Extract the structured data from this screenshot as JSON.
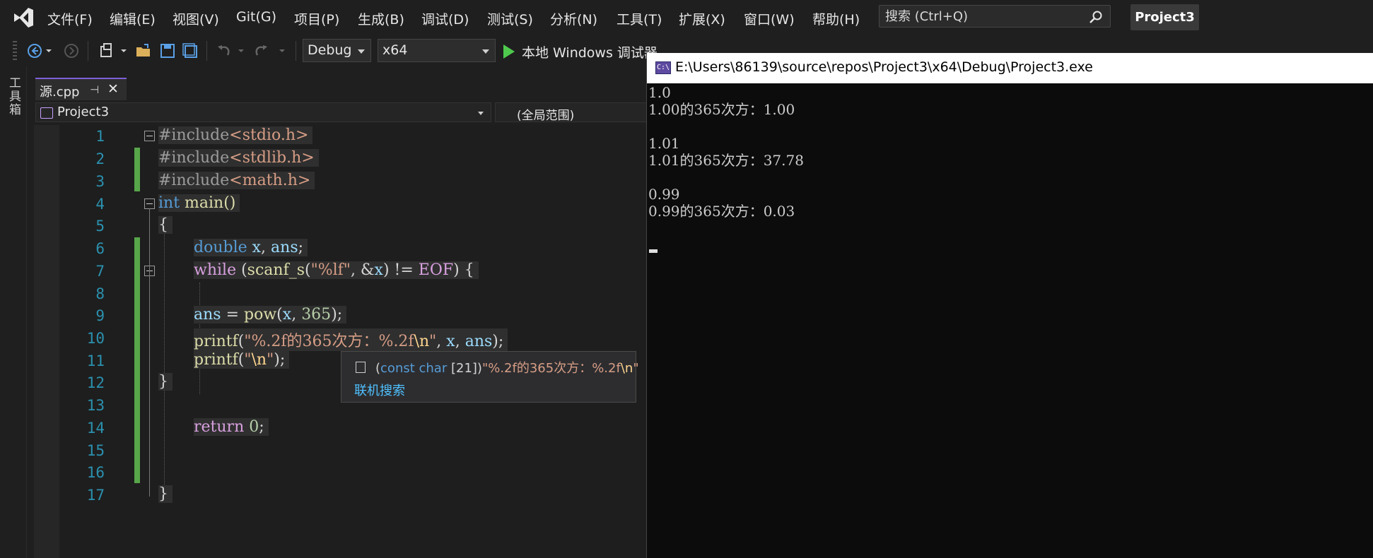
{
  "menubar": {
    "items": [
      "文件(F)",
      "编辑(E)",
      "视图(V)",
      "Git(G)",
      "项目(P)",
      "生成(B)",
      "调试(D)",
      "测试(S)",
      "分析(N)",
      "工具(T)",
      "扩展(X)",
      "窗口(W)",
      "帮助(H)"
    ],
    "search_placeholder": "搜索 (Ctrl+Q)",
    "project": "Project3"
  },
  "toolbar": {
    "config": "Debug",
    "platform": "x64",
    "run_label": "本地 Windows 调试器"
  },
  "sidebar": {
    "toolbox_label": "工具箱"
  },
  "editor": {
    "tab": {
      "label": "源.cpp",
      "pin": "⊣",
      "close": "✕"
    },
    "nav": {
      "project": "Project3",
      "scope": "(全局范围)"
    },
    "line_numbers": [
      "1",
      "2",
      "3",
      "4",
      "5",
      "6",
      "7",
      "8",
      "9",
      "10",
      "11",
      "12",
      "13",
      "14",
      "15",
      "16",
      "17"
    ],
    "code": {
      "l1_a": "#include",
      "l1_b": "<stdio.h>",
      "l2_a": "#include",
      "l2_b": "<stdlib.h>",
      "l3_a": "#include",
      "l3_b": "<math.h>",
      "l4_a": "int",
      "l4_b": " main()",
      "l5": "{",
      "l6_a": "double",
      "l6_b": " x",
      "l6_c": ", ",
      "l6_d": "ans",
      "l6_e": ";",
      "l7_a": "while",
      "l7_b": " (",
      "l7_c": "scanf_s",
      "l7_d": "(",
      "l7_e": "\"%lf\"",
      "l7_f": ", &",
      "l7_g": "x",
      "l7_h": ") != ",
      "l7_i": "EOF",
      "l7_j": ") {",
      "l9_a": "ans",
      "l9_b": " = ",
      "l9_c": "pow",
      "l9_d": "(",
      "l9_e": "x",
      "l9_f": ", ",
      "l9_g": "365",
      "l9_h": ");",
      "l10_a": "printf",
      "l10_b": "(",
      "l10_c": "\"%.2f的365次方：%.2f",
      "l10_d": "\\n",
      "l10_e": "\"",
      "l10_f": ", ",
      "l10_g": "x",
      "l10_h": ", ",
      "l10_i": "ans",
      "l10_j": ");",
      "l11_a": "printf",
      "l11_b": "(",
      "l11_c": "\"",
      "l11_d": "\\n",
      "l11_e": "\"",
      "l11_f": ");",
      "l12": "}",
      "l14_a": "return",
      "l14_b": " 0",
      "l14_c": ";",
      "l17": "}"
    },
    "tooltip": {
      "p1": "(",
      "p2": "const char",
      "p3": " [21])",
      "p4": "\"%.2f的365次方：%.2f",
      "p5": "\\n",
      "p6": "\"",
      "link": "联机搜索"
    }
  },
  "console": {
    "title": "E:\\Users\\86139\\source\\repos\\Project3\\x64\\Debug\\Project3.exe",
    "icon_text": "C:\\",
    "output": "1.0\n1.00的365次方：1.00\n\n1.01\n1.01的365次方：37.78\n\n0.99\n0.99的365次方：0.03"
  }
}
